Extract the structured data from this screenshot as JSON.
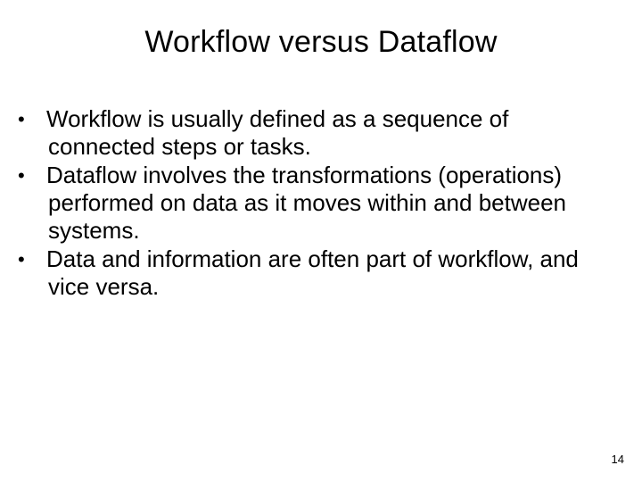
{
  "slide": {
    "title": "Workflow versus Dataflow",
    "bullets": [
      "Workflow is usually defined as a sequence of connected steps or tasks.",
      "Dataflow involves the transformations (operations) performed on data as it moves within and between systems.",
      "Data and information are often part of workflow, and vice versa."
    ],
    "page_number": "14"
  }
}
